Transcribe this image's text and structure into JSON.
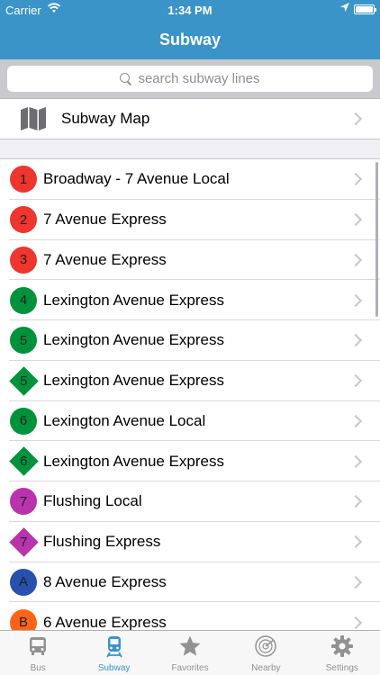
{
  "status_bar": {
    "carrier": "Carrier",
    "time": "1:34 PM"
  },
  "nav": {
    "title": "Subway"
  },
  "search": {
    "placeholder": "search subway lines"
  },
  "map_row": {
    "label": "Subway Map"
  },
  "lines": [
    {
      "code": "1",
      "name": "Broadway - 7 Avenue Local",
      "color": "#ee352e",
      "shape": "circle"
    },
    {
      "code": "2",
      "name": "7 Avenue Express",
      "color": "#ee352e",
      "shape": "circle"
    },
    {
      "code": "3",
      "name": "7 Avenue Express",
      "color": "#ee352e",
      "shape": "circle"
    },
    {
      "code": "4",
      "name": "Lexington Avenue Express",
      "color": "#00933c",
      "shape": "circle"
    },
    {
      "code": "5",
      "name": "Lexington Avenue Express",
      "color": "#00933c",
      "shape": "circle"
    },
    {
      "code": "5",
      "name": "Lexington Avenue Express",
      "color": "#00933c",
      "shape": "diamond"
    },
    {
      "code": "6",
      "name": "Lexington Avenue Local",
      "color": "#00933c",
      "shape": "circle"
    },
    {
      "code": "6",
      "name": "Lexington Avenue Express",
      "color": "#00933c",
      "shape": "diamond"
    },
    {
      "code": "7",
      "name": "Flushing Local",
      "color": "#b933ad",
      "shape": "circle"
    },
    {
      "code": "7",
      "name": "Flushing Express",
      "color": "#b933ad",
      "shape": "diamond"
    },
    {
      "code": "A",
      "name": "8 Avenue Express",
      "color": "#2850ad",
      "shape": "circle"
    },
    {
      "code": "B",
      "name": "6 Avenue Express",
      "color": "#ff6319",
      "shape": "circle"
    }
  ],
  "tabs": [
    {
      "label": "Bus",
      "icon": "bus-icon",
      "active": false
    },
    {
      "label": "Subway",
      "icon": "subway-icon",
      "active": true
    },
    {
      "label": "Favorites",
      "icon": "star-icon",
      "active": false
    },
    {
      "label": "Nearby",
      "icon": "radar-icon",
      "active": false
    },
    {
      "label": "Settings",
      "icon": "gear-icon",
      "active": false
    }
  ],
  "colors": {
    "accent": "#3a94c8"
  }
}
